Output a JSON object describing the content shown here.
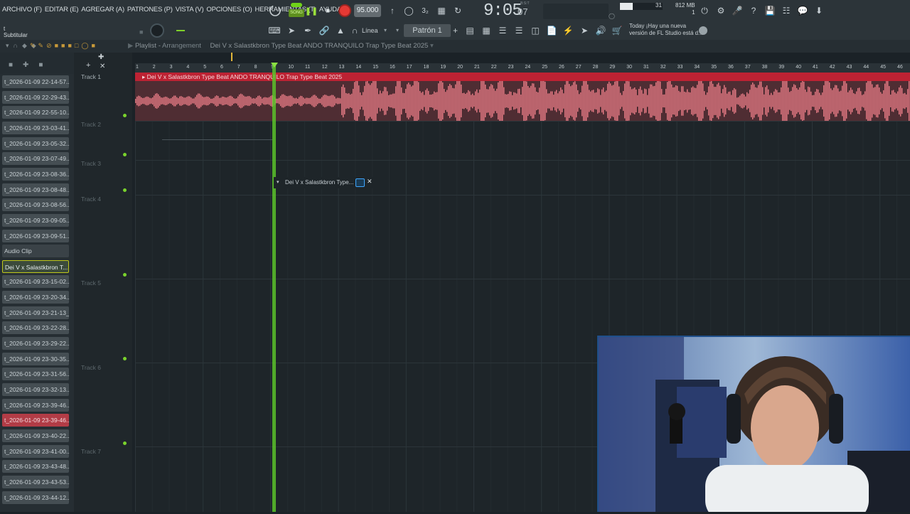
{
  "menu": [
    "ARCHIVO (F)",
    "EDITAR (E)",
    "AGREGAR (A)",
    "PATRONES (P)",
    "VISTA (V)",
    "OPCIONES (O)",
    "HERRAMIENTAS (T)",
    "AYUDA"
  ],
  "transport": {
    "song_label": "SONG",
    "tempo": "95.000",
    "time": "9:05",
    "time_small": "07",
    "time_sub": "B:S:T"
  },
  "system": {
    "cpu": "31",
    "mem_top": "812 MB",
    "mem_bottom": "1"
  },
  "hint": {
    "title": "t",
    "subtitle": "Subtitular"
  },
  "toolbar2": {
    "snap": "Línea",
    "pattern": "Patrón 1",
    "news": [
      "Today  ¡Hay una nueva",
      "versión de FL Studio está d..."
    ]
  },
  "playlist": {
    "title": "Playlist",
    "sep": "-",
    "mode": "Arrangement",
    "clip_name": "Dei V x Salastkbron Type Beat  ANDO TRANQUILO  Trap Type Beat 2025"
  },
  "browser_items": [
    "t_2026-01-09 22-14-57...",
    "t_2026-01-09 22-29-43...",
    "t_2026-01-09 22-55-10...",
    "t_2026-01-09 23-03-41...",
    "t_2026-01-09 23-05-32...",
    "t_2026-01-09 23-07-49...",
    "t_2026-01-09 23-08-36...",
    "t_2026-01-09 23-08-48...",
    "t_2026-01-09 23-08-56...",
    "t_2026-01-09 23-09-05...",
    "t_2026-01-09 23-09-51...",
    "Audio Clip",
    "Dei V x Salastkbron T...",
    "t_2026-01-09 23-15-02...",
    "t_2026-01-09 23-20-34...",
    "t_2026-01-09 23-21-13_...",
    "t_2026-01-09 23-22-28...",
    "t_2026-01-09 23-29-22...",
    "t_2026-01-09 23-30-35...",
    "t_2026-01-09 23-31-56...",
    "t_2026-01-09 23-32-13...",
    "t_2026-01-09 23-39-46...",
    "t_2026-01-09 23-39-46...",
    "t_2026-01-09 23-40-22...",
    "t_2026-01-09 23-41-00...",
    "t_2026-01-09 23-43-48...",
    "t_2026-01-09 23-43-53...",
    "t_2026-01-09 23-44-12..."
  ],
  "tracks": [
    "Track 1",
    "Track 2",
    "Track 3",
    "Track 4",
    "Track 5",
    "Track 6",
    "Track 7"
  ],
  "ruler": [
    "1",
    "2",
    "3",
    "4",
    "5",
    "6",
    "7",
    "8",
    "9",
    "10",
    "11",
    "12",
    "13",
    "14",
    "15",
    "16",
    "17",
    "18",
    "19",
    "20",
    "21",
    "22",
    "23",
    "24",
    "25",
    "26",
    "27",
    "28",
    "29",
    "30",
    "31",
    "32",
    "33",
    "34",
    "35",
    "36",
    "37",
    "38",
    "39",
    "40",
    "41",
    "42",
    "43",
    "44",
    "45",
    "46"
  ],
  "popup": {
    "label": "Dei V x Salastkbron Type..."
  },
  "colors": {
    "accent": "#8be043",
    "clip": "#bd2233",
    "wave": "#e87b85"
  }
}
